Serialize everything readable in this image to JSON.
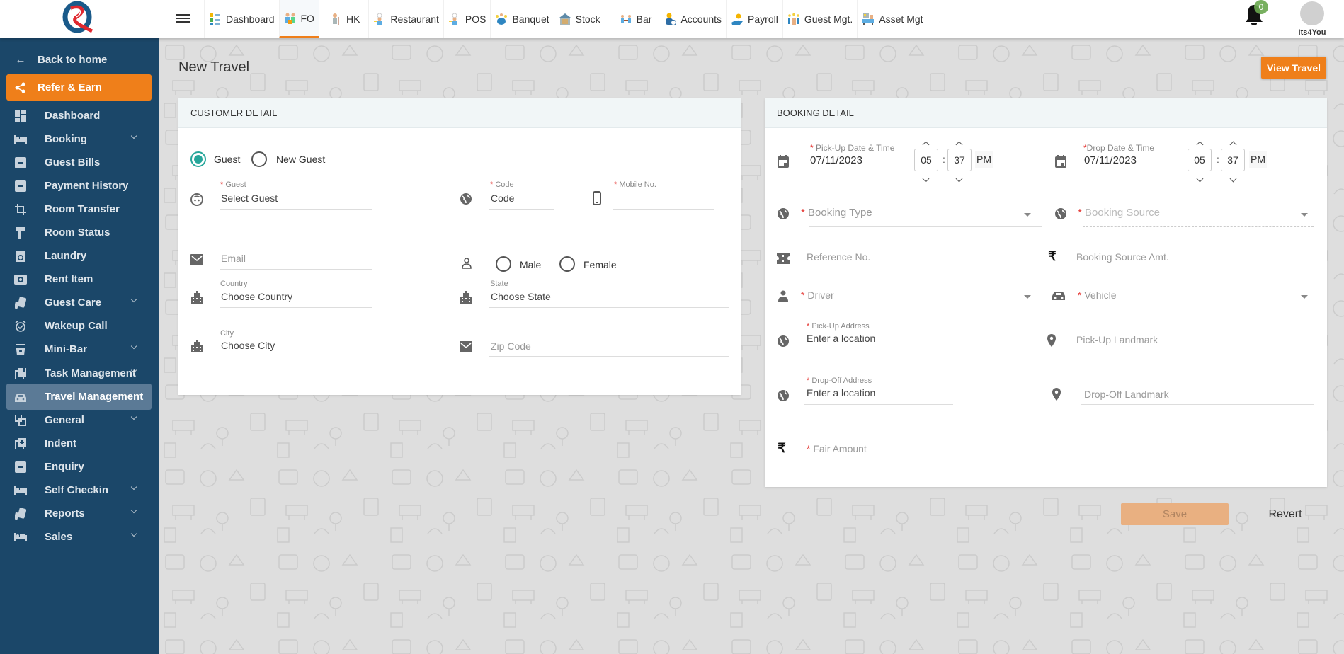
{
  "topbar": {
    "modules": [
      {
        "label": "Dashboard",
        "icon": "dashboard-module-icon",
        "active": false
      },
      {
        "label": "FO",
        "icon": "front-office-icon",
        "active": true
      },
      {
        "label": "HK",
        "icon": "housekeeping-icon",
        "active": false
      },
      {
        "label": "Restaurant",
        "icon": "restaurant-icon",
        "active": false
      },
      {
        "label": "POS",
        "icon": "pos-icon",
        "active": false
      },
      {
        "label": "Banquet",
        "icon": "banquet-icon",
        "active": false
      },
      {
        "label": "Stock",
        "icon": "stock-icon",
        "active": false
      },
      {
        "label": "Bar",
        "icon": "bar-icon",
        "active": false
      },
      {
        "label": "Accounts",
        "icon": "accounts-icon",
        "active": false
      },
      {
        "label": "Payroll",
        "icon": "payroll-icon",
        "active": false
      },
      {
        "label": "Guest Mgt.",
        "icon": "guest-mgt-icon",
        "active": false
      },
      {
        "label": "Asset Mgt",
        "icon": "asset-mgt-icon",
        "active": false
      }
    ],
    "notification_count": "0",
    "user_name": "Its4You"
  },
  "sidebar": {
    "back_label": "Back to home",
    "refer_label": "Refer & Earn",
    "items": [
      {
        "label": "Dashboard",
        "icon": "dashboard-icon",
        "chevron": false
      },
      {
        "label": "Booking",
        "icon": "bed-icon",
        "chevron": true
      },
      {
        "label": "Guest Bills",
        "icon": "bill-icon",
        "chevron": false
      },
      {
        "label": "Payment History",
        "icon": "bill-icon",
        "chevron": false
      },
      {
        "label": "Room Transfer",
        "icon": "transfer-icon",
        "chevron": false
      },
      {
        "label": "Room Status",
        "icon": "paint-roller-icon",
        "chevron": false
      },
      {
        "label": "Laundry",
        "icon": "washing-machine-icon",
        "chevron": false
      },
      {
        "label": "Rent Item",
        "icon": "rent-icon",
        "chevron": false
      },
      {
        "label": "Guest Care",
        "icon": "cards-icon",
        "chevron": true
      },
      {
        "label": "Wakeup Call",
        "icon": "alarm-icon",
        "chevron": false
      },
      {
        "label": "Mini-Bar",
        "icon": "glass-icon",
        "chevron": true
      },
      {
        "label": "Task Management",
        "icon": "tasks-icon",
        "chevron": true
      },
      {
        "label": "Travel Management",
        "icon": "car-icon",
        "chevron": false,
        "active": true
      },
      {
        "label": "General",
        "icon": "general-icon",
        "chevron": true
      },
      {
        "label": "Indent",
        "icon": "add-box-icon",
        "chevron": false
      },
      {
        "label": "Enquiry",
        "icon": "bill-icon",
        "chevron": false
      },
      {
        "label": "Self Checkin",
        "icon": "bed-icon",
        "chevron": true
      },
      {
        "label": "Reports",
        "icon": "cards-icon",
        "chevron": true
      },
      {
        "label": "Sales",
        "icon": "bed-icon",
        "chevron": true
      }
    ]
  },
  "page": {
    "title": "New Travel",
    "view_button": "View Travel",
    "save_button": "Save",
    "revert_button": "Revert"
  },
  "customer": {
    "heading": "CUSTOMER DETAIL",
    "radio_guest": "Guest",
    "radio_new_guest": "New Guest",
    "guest_type_selected": "Guest",
    "guest_label": "Guest",
    "guest_value": "Select Guest",
    "code_label": "Code",
    "code_value": "Code",
    "mobile_label": "Mobile No.",
    "mobile_value": "",
    "email_placeholder": "Email",
    "gender_male": "Male",
    "gender_female": "Female",
    "country_label": "Country",
    "country_value": "Choose Country",
    "state_label": "State",
    "state_value": "Choose State",
    "city_label": "City",
    "city_value": "Choose City",
    "zip_placeholder": "Zip Code"
  },
  "booking": {
    "heading": "BOOKING DETAIL",
    "pickup_label": "Pick-Up Date & Time",
    "pickup_date": "07/11/2023",
    "pickup_hour": "05",
    "pickup_minute": "37",
    "pickup_ampm": "PM",
    "drop_label": "Drop Date & Time",
    "drop_date": "07/11/2023",
    "drop_hour": "05",
    "drop_minute": "37",
    "drop_ampm": "PM",
    "booking_type_placeholder": "Booking Type",
    "booking_source_placeholder": "Booking Source",
    "reference_placeholder": "Reference No.",
    "source_amt_placeholder": "Booking Source Amt.",
    "driver_placeholder": "Driver",
    "vehicle_placeholder": "Vehicle",
    "pickup_address_label": "Pick-Up Address",
    "pickup_address_value": "Enter a location",
    "pickup_landmark_placeholder": "Pick-Up Landmark",
    "drop_address_label": "Drop-Off Address",
    "drop_address_value": "Enter a location",
    "drop_landmark_placeholder": "Drop-Off Landmark",
    "fair_amount_placeholder": "Fair Amount",
    "currency_symbol": "₹"
  },
  "colors": {
    "accent": "#ef7f1a",
    "sidebar": "#1b4769",
    "sidebar_active": "#5b7a96",
    "radio_checked": "#26a69a",
    "required": "#e53935"
  }
}
